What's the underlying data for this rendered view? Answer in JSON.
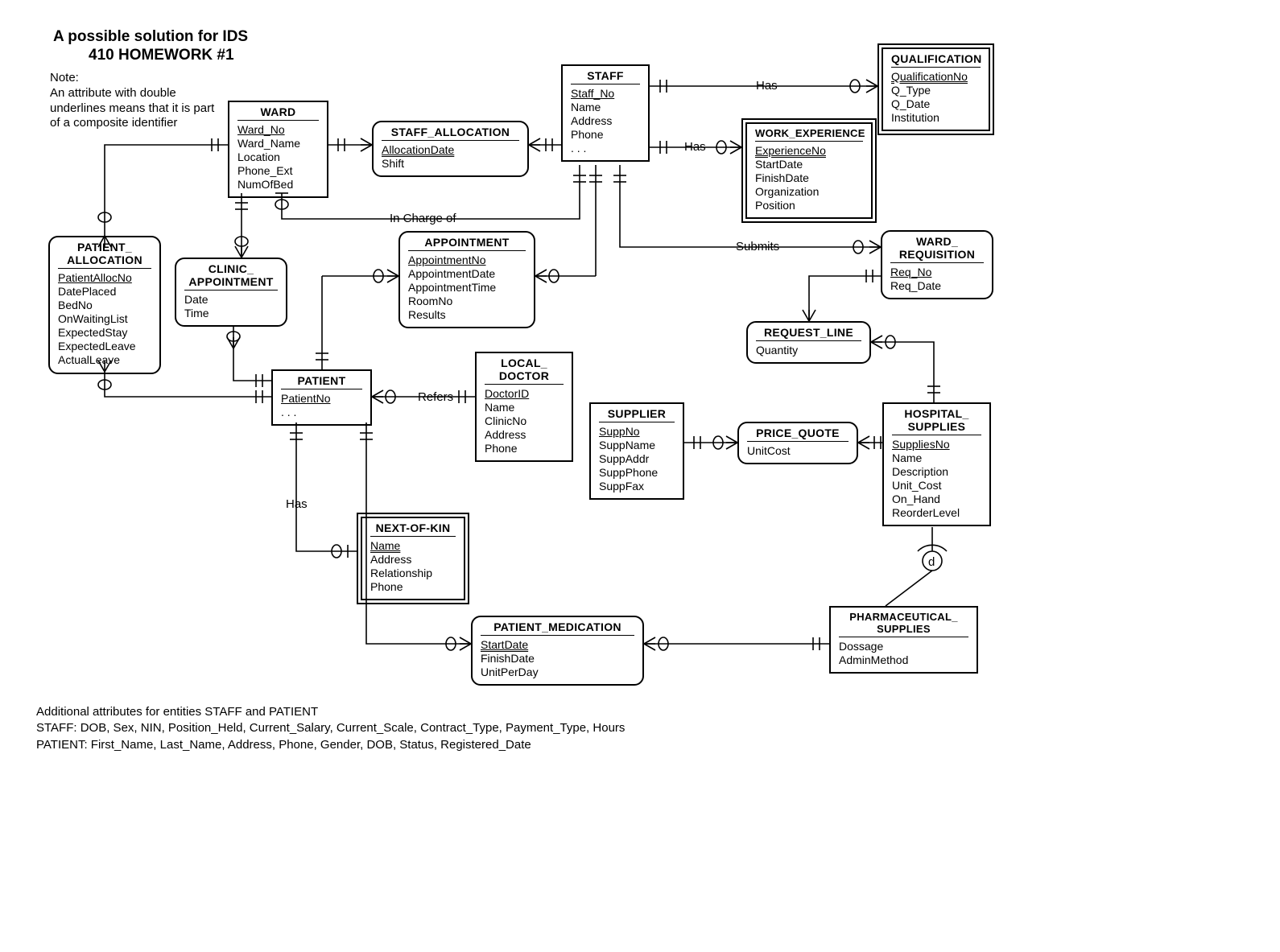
{
  "title_line1": "A possible solution for IDS",
  "title_line2": "410 HOMEWORK #1",
  "note_header": "Note:",
  "note_body1": "An attribute with double",
  "note_body2": "underlines  means that it is part",
  "note_body3": "of a composite identifier",
  "labels": {
    "in_charge_of": "In Charge of",
    "has_qual": "Has",
    "has_workexp": "Has",
    "has_kin": "Has",
    "refers": "Refers",
    "submits": "Submits",
    "d": "d"
  },
  "entities": {
    "staff": {
      "name": "STAFF",
      "attrs": [
        "Staff_No",
        "Name",
        "Address",
        "Phone",
        ". . ."
      ],
      "pk": [
        "Staff_No"
      ]
    },
    "ward": {
      "name": "WARD",
      "attrs": [
        "Ward_No",
        "Ward_Name",
        "Location",
        "Phone_Ext",
        "NumOfBed"
      ],
      "pk": [
        "Ward_No"
      ]
    },
    "qualification": {
      "name": "QUALIFICATION",
      "attrs": [
        "QualificationNo",
        "Q_Type",
        "Q_Date",
        "Institution"
      ],
      "pk": [
        "QualificationNo"
      ],
      "weak": true
    },
    "work_experience": {
      "name": "WORK_EXPERIENCE",
      "attrs": [
        "ExperienceNo",
        "StartDate",
        "FinishDate",
        "Organization",
        "Position"
      ],
      "pk": [
        "ExperienceNo"
      ],
      "weak": true
    },
    "staff_allocation": {
      "name": "STAFF_ALLOCATION",
      "attrs": [
        "AllocationDate",
        "Shift"
      ],
      "pk": [
        "AllocationDate"
      ],
      "assoc": true
    },
    "patient_allocation": {
      "name": "PATIENT_\nALLOCATION",
      "attrs": [
        "PatientAllocNo",
        "DatePlaced",
        "BedNo",
        "OnWaitingList",
        "ExpectedStay",
        "ExpectedLeave",
        "ActualLeave"
      ],
      "pk": [
        "PatientAllocNo"
      ],
      "assoc": true
    },
    "clinic_appointment": {
      "name": "CLINIC_\nAPPOINTMENT",
      "attrs": [
        "Date",
        "Time"
      ],
      "assoc": true
    },
    "appointment": {
      "name": "APPOINTMENT",
      "attrs": [
        "AppointmentNo",
        "AppointmentDate",
        "AppointmentTime",
        "RoomNo",
        "Results"
      ],
      "pk": [
        "AppointmentNo"
      ],
      "assoc": true
    },
    "patient": {
      "name": "PATIENT",
      "attrs": [
        "PatientNo",
        ". . ."
      ],
      "pk": [
        "PatientNo"
      ]
    },
    "local_doctor": {
      "name": "LOCAL_\nDOCTOR",
      "attrs": [
        "DoctorID",
        "Name",
        "ClinicNo",
        "Address",
        "Phone"
      ],
      "pk": [
        "DoctorID"
      ]
    },
    "supplier": {
      "name": "SUPPLIER",
      "attrs": [
        "SuppNo",
        "SuppName",
        "SuppAddr",
        "SuppPhone",
        "SuppFax"
      ],
      "pk": [
        "SuppNo"
      ]
    },
    "price_quote": {
      "name": "PRICE_QUOTE",
      "attrs": [
        "UnitCost"
      ],
      "assoc": true
    },
    "ward_requisition": {
      "name": "WARD_\nREQUISITION",
      "attrs": [
        "Req_No",
        "Req_Date"
      ],
      "pk": [
        "Req_No"
      ],
      "assoc": true
    },
    "request_line": {
      "name": "REQUEST_LINE",
      "attrs": [
        "Quantity"
      ],
      "assoc": true
    },
    "hospital_supplies": {
      "name": "HOSPITAL_\nSUPPLIES",
      "attrs": [
        "SuppliesNo",
        "Name",
        "Description",
        "Unit_Cost",
        "On_Hand",
        "ReorderLevel"
      ],
      "pk": [
        "SuppliesNo"
      ]
    },
    "next_of_kin": {
      "name": "NEXT-OF-KIN",
      "attrs": [
        "Name",
        "Address",
        "Relationship",
        "Phone"
      ],
      "pk": [
        "Name"
      ],
      "weak": true
    },
    "patient_medication": {
      "name": "PATIENT_MEDICATION",
      "attrs": [
        "StartDate",
        "FinishDate",
        "UnitPerDay"
      ],
      "pk": [
        "StartDate"
      ],
      "assoc": true
    },
    "pharmaceutical_supplies": {
      "name": "PHARMACEUTICAL_\nSUPPLIES",
      "attrs": [
        "Dossage",
        "AdminMethod"
      ]
    }
  },
  "footer": {
    "line1": "Additional attributes for entities STAFF and PATIENT",
    "line2": "STAFF: DOB, Sex, NIN, Position_Held, Current_Salary, Current_Scale, Contract_Type, Payment_Type, Hours",
    "line3": "PATIENT: First_Name, Last_Name, Address, Phone, Gender, DOB, Status, Registered_Date"
  }
}
